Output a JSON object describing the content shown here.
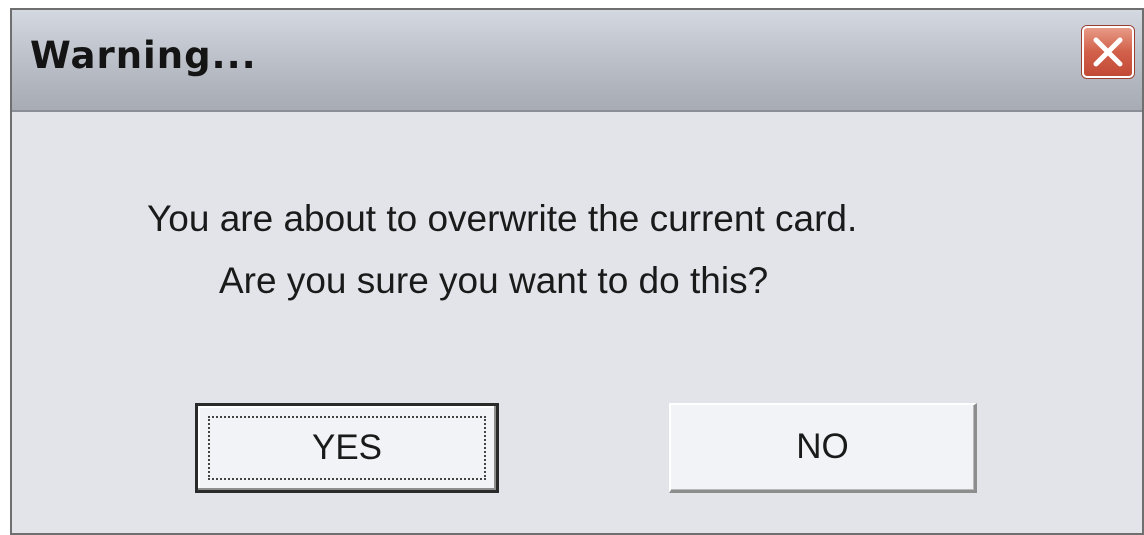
{
  "dialog": {
    "title": "Warning...",
    "message_line1": "You are about to overwrite the current card.",
    "message_line2": "Are you sure you want to do this?",
    "close_icon": "close-icon"
  },
  "buttons": {
    "yes_label": "YES",
    "no_label": "NO"
  },
  "colors": {
    "close_button": "#d2604a",
    "dialog_background": "#e2e4ea",
    "titlebar": "#bfc3cc"
  }
}
